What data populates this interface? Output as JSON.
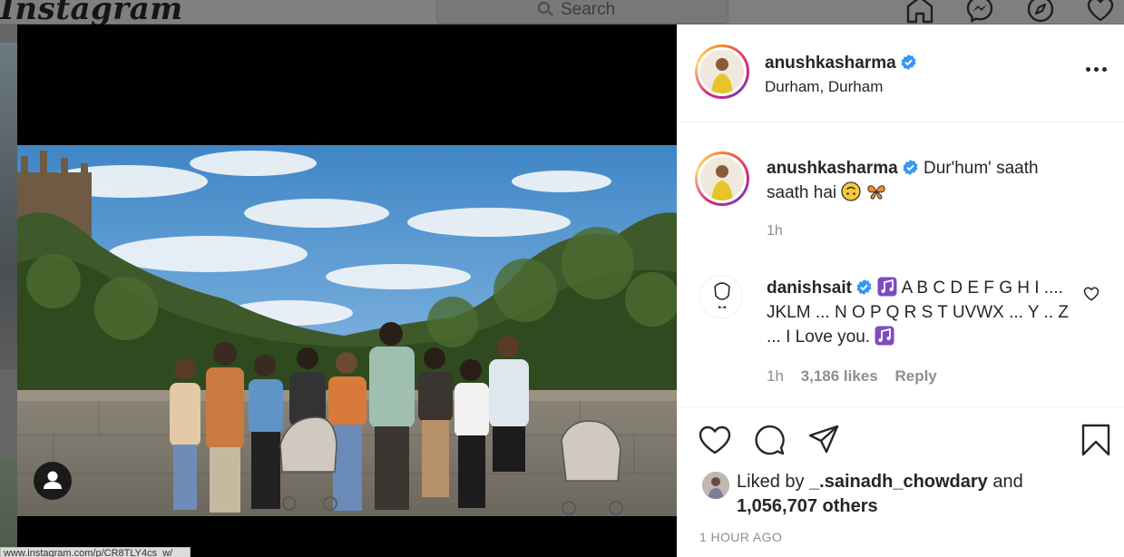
{
  "background": {
    "logo": "Instagram",
    "search_placeholder": "Search",
    "status_url": "www.instagram.com/p/CR8TLY4cs_w/"
  },
  "post": {
    "author": "anushkasharma",
    "location": "Durham, Durham",
    "caption_text": "Dur'hum' saath saath hai",
    "caption_emojis": [
      "upside-down-face-icon",
      "butterfly-icon"
    ],
    "caption_time": "1h",
    "comment": {
      "author": "danishsait",
      "text_1": "A B C D E F G H I .... JKLM ... N O P Q R S T UVWX ... Y .. Z ... I Love you.",
      "time": "1h",
      "likes": "3,186 likes",
      "reply_label": "Reply"
    },
    "liked_by_prefix": "Liked by",
    "liked_by_user": "_.sainadh_chowdary",
    "liked_by_and": "and",
    "liked_by_others": "1,056,707 others",
    "timestamp": "1 HOUR AGO"
  },
  "colors": {
    "verified_blue": "#3897f0",
    "text_primary": "#262626",
    "text_secondary": "#8e8e8e",
    "music_purple": "#7d4cc0"
  }
}
